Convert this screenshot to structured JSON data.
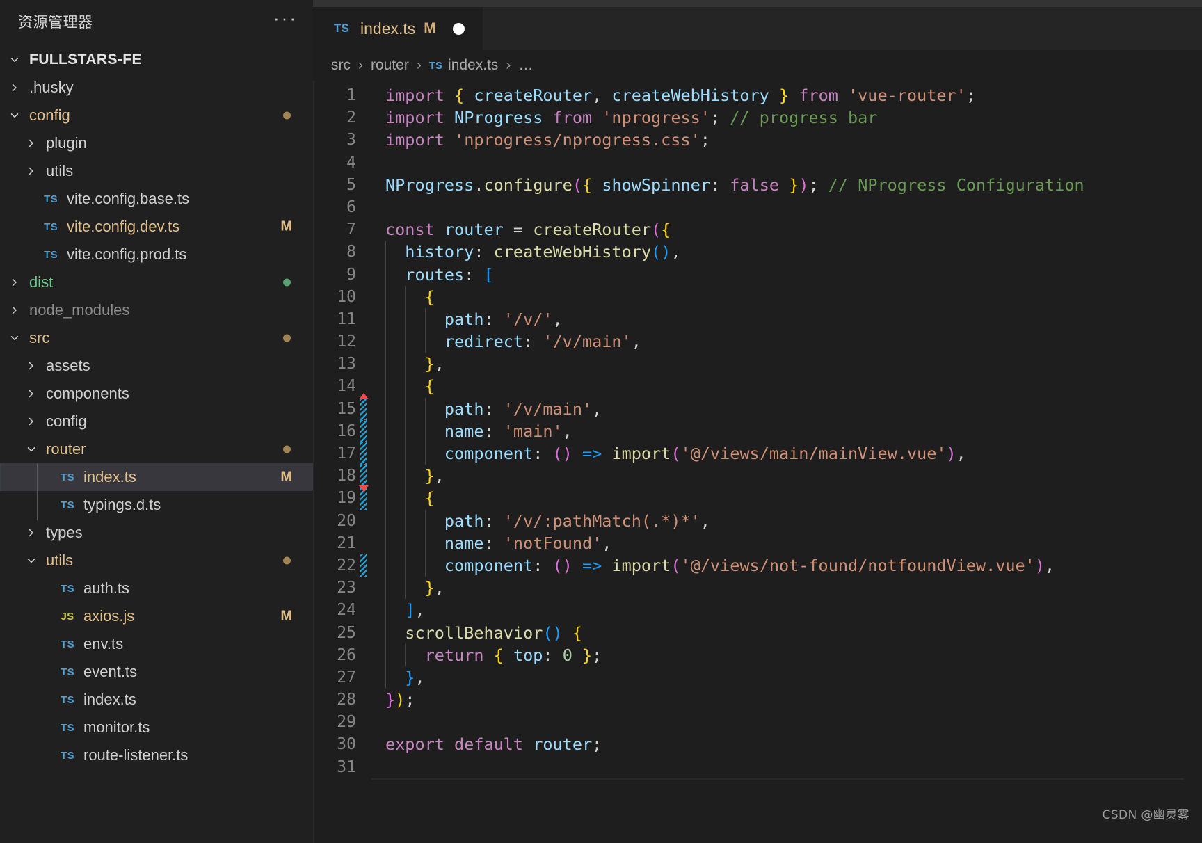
{
  "sidebar": {
    "title": "资源管理器",
    "more_label": "···",
    "root": {
      "label": "FULLSTARS-FE"
    },
    "items": [
      {
        "label": ".husky",
        "kind": "folder",
        "expanded": false,
        "depth": 1,
        "color": "white",
        "icon": "chevron-right-icon"
      },
      {
        "label": "config",
        "kind": "folder",
        "expanded": true,
        "depth": 1,
        "color": "mod",
        "icon": "chevron-down-icon",
        "dot": "mod"
      },
      {
        "label": "plugin",
        "kind": "folder",
        "expanded": false,
        "depth": 2,
        "color": "white",
        "icon": "chevron-right-icon"
      },
      {
        "label": "utils",
        "kind": "folder",
        "expanded": false,
        "depth": 2,
        "color": "white",
        "icon": "chevron-right-icon"
      },
      {
        "label": "vite.config.base.ts",
        "kind": "file",
        "depth": 2,
        "color": "white",
        "icon": "ts-file-icon",
        "ext": "TS"
      },
      {
        "label": "vite.config.dev.ts",
        "kind": "file",
        "depth": 2,
        "color": "mod",
        "icon": "ts-file-icon",
        "ext": "TS",
        "badge": "M"
      },
      {
        "label": "vite.config.prod.ts",
        "kind": "file",
        "depth": 2,
        "color": "white",
        "icon": "ts-file-icon",
        "ext": "TS"
      },
      {
        "label": "dist",
        "kind": "folder",
        "expanded": false,
        "depth": 1,
        "color": "new",
        "icon": "chevron-right-icon",
        "dot": "new"
      },
      {
        "label": "node_modules",
        "kind": "folder",
        "expanded": false,
        "depth": 1,
        "color": "ign",
        "icon": "chevron-right-icon"
      },
      {
        "label": "src",
        "kind": "folder",
        "expanded": true,
        "depth": 1,
        "color": "mod",
        "icon": "chevron-down-icon",
        "dot": "mod"
      },
      {
        "label": "assets",
        "kind": "folder",
        "expanded": false,
        "depth": 2,
        "color": "white",
        "icon": "chevron-right-icon"
      },
      {
        "label": "components",
        "kind": "folder",
        "expanded": false,
        "depth": 2,
        "color": "white",
        "icon": "chevron-right-icon"
      },
      {
        "label": "config",
        "kind": "folder",
        "expanded": false,
        "depth": 2,
        "color": "white",
        "icon": "chevron-right-icon"
      },
      {
        "label": "router",
        "kind": "folder",
        "expanded": true,
        "depth": 2,
        "color": "mod",
        "icon": "chevron-down-icon",
        "dot": "mod"
      },
      {
        "label": "index.ts",
        "kind": "file",
        "depth": 3,
        "color": "mod",
        "icon": "ts-file-icon",
        "ext": "TS",
        "badge": "M",
        "selected": true
      },
      {
        "label": "typings.d.ts",
        "kind": "file",
        "depth": 3,
        "color": "white",
        "icon": "ts-file-icon",
        "ext": "TS"
      },
      {
        "label": "types",
        "kind": "folder",
        "expanded": false,
        "depth": 2,
        "color": "white",
        "icon": "chevron-right-icon"
      },
      {
        "label": "utils",
        "kind": "folder",
        "expanded": true,
        "depth": 2,
        "color": "mod",
        "icon": "chevron-down-icon",
        "dot": "mod"
      },
      {
        "label": "auth.ts",
        "kind": "file",
        "depth": 3,
        "color": "white",
        "icon": "ts-file-icon",
        "ext": "TS"
      },
      {
        "label": "axios.js",
        "kind": "file",
        "depth": 3,
        "color": "mod",
        "icon": "js-file-icon",
        "ext": "JS",
        "badge": "M"
      },
      {
        "label": "env.ts",
        "kind": "file",
        "depth": 3,
        "color": "white",
        "icon": "ts-file-icon",
        "ext": "TS"
      },
      {
        "label": "event.ts",
        "kind": "file",
        "depth": 3,
        "color": "white",
        "icon": "ts-file-icon",
        "ext": "TS"
      },
      {
        "label": "index.ts",
        "kind": "file",
        "depth": 3,
        "color": "white",
        "icon": "ts-file-icon",
        "ext": "TS"
      },
      {
        "label": "monitor.ts",
        "kind": "file",
        "depth": 3,
        "color": "white",
        "icon": "ts-file-icon",
        "ext": "TS"
      },
      {
        "label": "route-listener.ts",
        "kind": "file",
        "depth": 3,
        "color": "white",
        "icon": "ts-file-icon",
        "ext": "TS"
      }
    ]
  },
  "editor": {
    "tab": {
      "ext": "TS",
      "name": "index.ts",
      "modified_badge": "M",
      "dirty": true
    },
    "breadcrumb": {
      "parts": [
        "src",
        "router",
        "index.ts",
        "…"
      ],
      "file_ext": "TS",
      "separator": "›"
    },
    "watermark": "CSDN @幽灵雾",
    "lines": [
      {
        "n": "1",
        "guides": 0,
        "tokens": [
          [
            "kw",
            "import "
          ],
          [
            "b1",
            "{"
          ],
          [
            "pl",
            " "
          ],
          [
            "id",
            "createRouter"
          ],
          [
            "pl",
            ", "
          ],
          [
            "id",
            "createWebHistory"
          ],
          [
            "pl",
            " "
          ],
          [
            "b1",
            "}"
          ],
          [
            "kw",
            " from "
          ],
          [
            "str",
            "'vue-router'"
          ],
          [
            "pl",
            ";"
          ]
        ]
      },
      {
        "n": "2",
        "guides": 0,
        "tokens": [
          [
            "kw",
            "import "
          ],
          [
            "id",
            "NProgress"
          ],
          [
            "kw",
            " from "
          ],
          [
            "str",
            "'nprogress'"
          ],
          [
            "pl",
            ";"
          ],
          [
            "cm",
            " // progress bar"
          ]
        ]
      },
      {
        "n": "3",
        "guides": 0,
        "tokens": [
          [
            "kw",
            "import "
          ],
          [
            "str",
            "'nprogress/nprogress.css'"
          ],
          [
            "pl",
            ";"
          ]
        ]
      },
      {
        "n": "4",
        "guides": 0,
        "tokens": []
      },
      {
        "n": "5",
        "guides": 0,
        "tokens": [
          [
            "id",
            "NProgress"
          ],
          [
            "pl",
            "."
          ],
          [
            "fn",
            "configure"
          ],
          [
            "b2",
            "("
          ],
          [
            "b1",
            "{"
          ],
          [
            "pl",
            " "
          ],
          [
            "id",
            "showSpinner"
          ],
          [
            "pl",
            ": "
          ],
          [
            "kw",
            "false"
          ],
          [
            "pl",
            " "
          ],
          [
            "b1",
            "}"
          ],
          [
            "b2",
            ")"
          ],
          [
            "pl",
            ";"
          ],
          [
            "cm",
            " // NProgress Configuration"
          ]
        ]
      },
      {
        "n": "6",
        "guides": 0,
        "tokens": []
      },
      {
        "n": "7",
        "guides": 0,
        "tokens": [
          [
            "kw",
            "const "
          ],
          [
            "id",
            "router"
          ],
          [
            "pl",
            " = "
          ],
          [
            "fn",
            "createRouter"
          ],
          [
            "b2",
            "("
          ],
          [
            "b1",
            "{"
          ]
        ]
      },
      {
        "n": "8",
        "guides": 1,
        "tokens": [
          [
            "pl",
            "  "
          ],
          [
            "id",
            "history"
          ],
          [
            "pl",
            ": "
          ],
          [
            "fn",
            "createWebHistory"
          ],
          [
            "b3",
            "()"
          ],
          [
            "pl",
            ","
          ]
        ]
      },
      {
        "n": "9",
        "guides": 1,
        "tokens": [
          [
            "pl",
            "  "
          ],
          [
            "id",
            "routes"
          ],
          [
            "pl",
            ": "
          ],
          [
            "b3",
            "["
          ]
        ]
      },
      {
        "n": "10",
        "guides": 2,
        "tokens": [
          [
            "pl",
            "    "
          ],
          [
            "b1",
            "{"
          ]
        ]
      },
      {
        "n": "11",
        "guides": 3,
        "tokens": [
          [
            "pl",
            "      "
          ],
          [
            "id",
            "path"
          ],
          [
            "pl",
            ": "
          ],
          [
            "str",
            "'/v/'"
          ],
          [
            "pl",
            ","
          ]
        ]
      },
      {
        "n": "12",
        "guides": 3,
        "tokens": [
          [
            "pl",
            "      "
          ],
          [
            "id",
            "redirect"
          ],
          [
            "pl",
            ": "
          ],
          [
            "str",
            "'/v/main'"
          ],
          [
            "pl",
            ","
          ]
        ]
      },
      {
        "n": "13",
        "guides": 2,
        "tokens": [
          [
            "pl",
            "    "
          ],
          [
            "b1",
            "}"
          ],
          [
            "pl",
            ","
          ]
        ]
      },
      {
        "n": "14",
        "guides": 2,
        "tokens": [
          [
            "pl",
            "    "
          ],
          [
            "b1",
            "{"
          ]
        ]
      },
      {
        "n": "15",
        "guides": 3,
        "diff": "start",
        "tokens": [
          [
            "pl",
            "      "
          ],
          [
            "id",
            "path"
          ],
          [
            "pl",
            ": "
          ],
          [
            "str",
            "'/v/main'"
          ],
          [
            "pl",
            ","
          ]
        ]
      },
      {
        "n": "16",
        "guides": 3,
        "diff": "mid",
        "tokens": [
          [
            "pl",
            "      "
          ],
          [
            "id",
            "name"
          ],
          [
            "pl",
            ": "
          ],
          [
            "str",
            "'main'"
          ],
          [
            "pl",
            ","
          ]
        ]
      },
      {
        "n": "17",
        "guides": 3,
        "diff": "mid",
        "tokens": [
          [
            "pl",
            "      "
          ],
          [
            "id",
            "component"
          ],
          [
            "pl",
            ": "
          ],
          [
            "b2",
            "()"
          ],
          [
            "pl",
            " "
          ],
          [
            "b3",
            "=>"
          ],
          [
            "pl",
            " "
          ],
          [
            "fn",
            "import"
          ],
          [
            "b2",
            "("
          ],
          [
            "str",
            "'@/views/main/mainView.vue'"
          ],
          [
            "b2",
            ")"
          ],
          [
            "pl",
            ","
          ]
        ]
      },
      {
        "n": "18",
        "guides": 2,
        "diff": "mid",
        "tokens": [
          [
            "pl",
            "    "
          ],
          [
            "b1",
            "}"
          ],
          [
            "pl",
            ","
          ]
        ]
      },
      {
        "n": "19",
        "guides": 2,
        "diff": "end",
        "tokens": [
          [
            "pl",
            "    "
          ],
          [
            "b1",
            "{"
          ]
        ]
      },
      {
        "n": "20",
        "guides": 3,
        "tokens": [
          [
            "pl",
            "      "
          ],
          [
            "id",
            "path"
          ],
          [
            "pl",
            ": "
          ],
          [
            "str",
            "'/v/:pathMatch(.*)*'"
          ],
          [
            "pl",
            ","
          ]
        ]
      },
      {
        "n": "21",
        "guides": 3,
        "tokens": [
          [
            "pl",
            "      "
          ],
          [
            "id",
            "name"
          ],
          [
            "pl",
            ": "
          ],
          [
            "str",
            "'notFound'"
          ],
          [
            "pl",
            ","
          ]
        ]
      },
      {
        "n": "22",
        "guides": 3,
        "diff": "only",
        "tokens": [
          [
            "pl",
            "      "
          ],
          [
            "id",
            "component"
          ],
          [
            "pl",
            ": "
          ],
          [
            "b2",
            "()"
          ],
          [
            "pl",
            " "
          ],
          [
            "b3",
            "=>"
          ],
          [
            "pl",
            " "
          ],
          [
            "fn",
            "import"
          ],
          [
            "b2",
            "("
          ],
          [
            "str",
            "'@/views/not-found/notfoundView.vue'"
          ],
          [
            "b2",
            ")"
          ],
          [
            "pl",
            ","
          ]
        ]
      },
      {
        "n": "23",
        "guides": 2,
        "tokens": [
          [
            "pl",
            "    "
          ],
          [
            "b1",
            "}"
          ],
          [
            "pl",
            ","
          ]
        ]
      },
      {
        "n": "24",
        "guides": 1,
        "tokens": [
          [
            "pl",
            "  "
          ],
          [
            "b3",
            "]"
          ],
          [
            "pl",
            ","
          ]
        ]
      },
      {
        "n": "25",
        "guides": 1,
        "tokens": [
          [
            "pl",
            "  "
          ],
          [
            "fn",
            "scrollBehavior"
          ],
          [
            "b3",
            "()"
          ],
          [
            "pl",
            " "
          ],
          [
            "b1",
            "{"
          ]
        ]
      },
      {
        "n": "26",
        "guides": 2,
        "tokens": [
          [
            "pl",
            "    "
          ],
          [
            "kw",
            "return"
          ],
          [
            "pl",
            " "
          ],
          [
            "b1",
            "{"
          ],
          [
            "pl",
            " "
          ],
          [
            "id",
            "top"
          ],
          [
            "pl",
            ": "
          ],
          [
            "num",
            "0"
          ],
          [
            "pl",
            " "
          ],
          [
            "b1",
            "}"
          ],
          [
            "pl",
            ";"
          ]
        ]
      },
      {
        "n": "27",
        "guides": 1,
        "tokens": [
          [
            "pl",
            "  "
          ],
          [
            "b3",
            "}"
          ],
          [
            "pl",
            ","
          ]
        ]
      },
      {
        "n": "28",
        "guides": 0,
        "tokens": [
          [
            "b2",
            "}"
          ],
          [
            "b1",
            ")"
          ],
          [
            "pl",
            ";"
          ]
        ]
      },
      {
        "n": "29",
        "guides": 0,
        "tokens": []
      },
      {
        "n": "30",
        "guides": 0,
        "tokens": [
          [
            "kw",
            "export default "
          ],
          [
            "id",
            "router"
          ],
          [
            "pl",
            ";"
          ]
        ]
      },
      {
        "n": "31",
        "guides": 0,
        "tokens": []
      }
    ]
  },
  "colors": {
    "background": "#1e1e1e",
    "sidebar_background": "#202020",
    "selection": "#37373d",
    "keyword": "#c586c0",
    "identifier": "#9cdcfe",
    "function": "#dcdcaa",
    "string": "#ce9178",
    "comment": "#6a9955",
    "number": "#b5cea8",
    "git_modified": "#e2c08d",
    "git_untracked": "#73c991",
    "git_ignored": "#8c8c8c",
    "diff_marker": "#1e9fd8",
    "diff_arrow": "#f14c4c"
  }
}
